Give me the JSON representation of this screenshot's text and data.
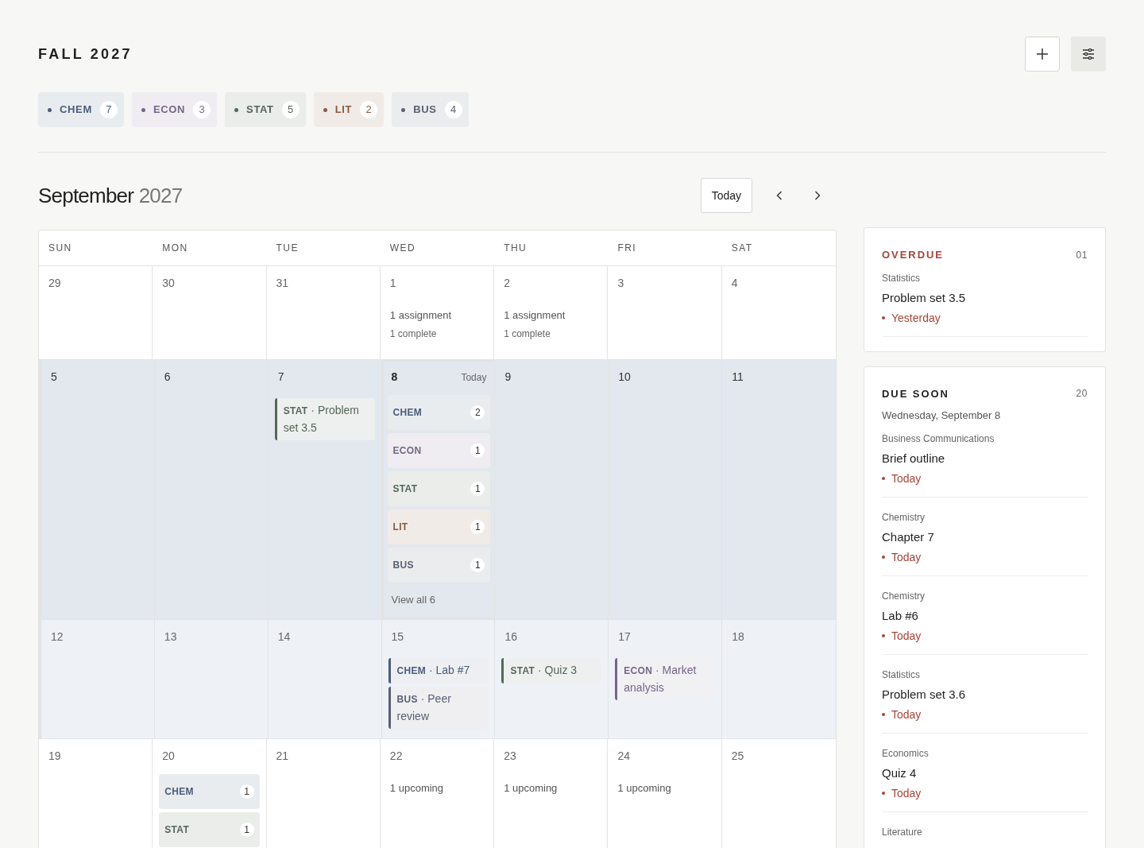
{
  "term": "FALL 2027",
  "courses": [
    {
      "label": "CHEM",
      "count": "7",
      "color": "#4a5d7a"
    },
    {
      "label": "ECON",
      "count": "3",
      "color": "#76668a"
    },
    {
      "label": "STAT",
      "count": "5",
      "color": "#55675b"
    },
    {
      "label": "LIT",
      "count": "2",
      "color": "#8a5a3e"
    },
    {
      "label": "BUS",
      "count": "4",
      "color": "#5a5f73"
    }
  ],
  "calendar": {
    "month": "September",
    "year": "2027",
    "today_button": "Today",
    "weekdays": [
      "SUN",
      "MON",
      "TUE",
      "WED",
      "THU",
      "FRI",
      "SAT"
    ],
    "weeks": [
      {
        "kind": "plain",
        "days": [
          {
            "date": "29",
            "selected": false
          },
          {
            "date": "30",
            "selected": false
          },
          {
            "date": "31",
            "selected": false
          },
          {
            "date": "1",
            "selected": false,
            "summary": [
              "1 assignment",
              "1 complete"
            ]
          },
          {
            "date": "2",
            "selected": false,
            "summary": [
              "1 assignment",
              "1 complete"
            ]
          },
          {
            "date": "3",
            "selected": false
          },
          {
            "date": "4",
            "selected": false
          }
        ]
      },
      {
        "kind": "current",
        "days": [
          {
            "date": "5",
            "selected": false
          },
          {
            "date": "6",
            "selected": false
          },
          {
            "date": "7",
            "selected": false,
            "events": [
              {
                "label": "**STAT** · Problem set 3.5",
                "color": "#55675b"
              }
            ]
          },
          {
            "date": "8",
            "selected": true,
            "note": "Today",
            "groups": [
              {
                "label": "CHEM",
                "count": "2",
                "color": "#4a5d7a"
              },
              {
                "label": "ECON",
                "count": "1",
                "color": "#76668a"
              },
              {
                "label": "STAT",
                "count": "1",
                "color": "#55675b"
              },
              {
                "label": "LIT",
                "count": "1",
                "color": "#8a5a3e"
              },
              {
                "label": "BUS",
                "count": "1",
                "color": "#5a5f73"
              }
            ],
            "more": "View all 6"
          },
          {
            "date": "9",
            "selected": false
          },
          {
            "date": "10",
            "selected": false
          },
          {
            "date": "11",
            "selected": false
          }
        ]
      },
      {
        "kind": "next",
        "days": [
          {
            "date": "12",
            "selected": false
          },
          {
            "date": "13",
            "selected": false
          },
          {
            "date": "14",
            "selected": false
          },
          {
            "date": "15",
            "selected": false,
            "events": [
              {
                "label": "**CHEM** · Lab #7",
                "color": "#4a5d7a"
              },
              {
                "label": "**BUS** · Peer review",
                "color": "#5a5f73"
              }
            ]
          },
          {
            "date": "16",
            "selected": false,
            "events": [
              {
                "label": "**STAT** · Quiz 3",
                "color": "#55675b"
              }
            ]
          },
          {
            "date": "17",
            "selected": false,
            "events": [
              {
                "label": "**ECON** · Market analysis",
                "color": "#76668a"
              }
            ]
          },
          {
            "date": "18",
            "selected": false
          }
        ]
      },
      {
        "kind": "plain",
        "days": [
          {
            "date": "19",
            "selected": false
          },
          {
            "date": "20",
            "selected": false,
            "groups": [
              {
                "label": "CHEM",
                "count": "1",
                "color": "#4a5d7a"
              },
              {
                "label": "STAT",
                "count": "1",
                "color": "#55675b"
              }
            ]
          },
          {
            "date": "21",
            "selected": false
          },
          {
            "date": "22",
            "selected": false,
            "summary": [
              "1 upcoming"
            ]
          },
          {
            "date": "23",
            "selected": false,
            "summary": [
              "1 upcoming"
            ]
          },
          {
            "date": "24",
            "selected": false,
            "summary": [
              "1 upcoming"
            ]
          },
          {
            "date": "25",
            "selected": false
          }
        ]
      }
    ]
  },
  "overdue": {
    "title": "OVERDUE",
    "count": "01",
    "items": [
      {
        "course": "Statistics",
        "title": "Problem set 3.5",
        "due": "Yesterday"
      }
    ]
  },
  "due_soon": {
    "title": "DUE SOON",
    "count": "20",
    "subtitle": "Wednesday, September 8",
    "items": [
      {
        "course": "Business Communications",
        "title": "Brief outline",
        "due": "Today"
      },
      {
        "course": "Chemistry",
        "title": "Chapter 7",
        "due": "Today"
      },
      {
        "course": "Chemistry",
        "title": "Lab #6",
        "due": "Today"
      },
      {
        "course": "Statistics",
        "title": "Problem set 3.6",
        "due": "Today"
      },
      {
        "course": "Economics",
        "title": "Quiz 4",
        "due": "Today"
      },
      {
        "course": "Literature"
      }
    ]
  }
}
